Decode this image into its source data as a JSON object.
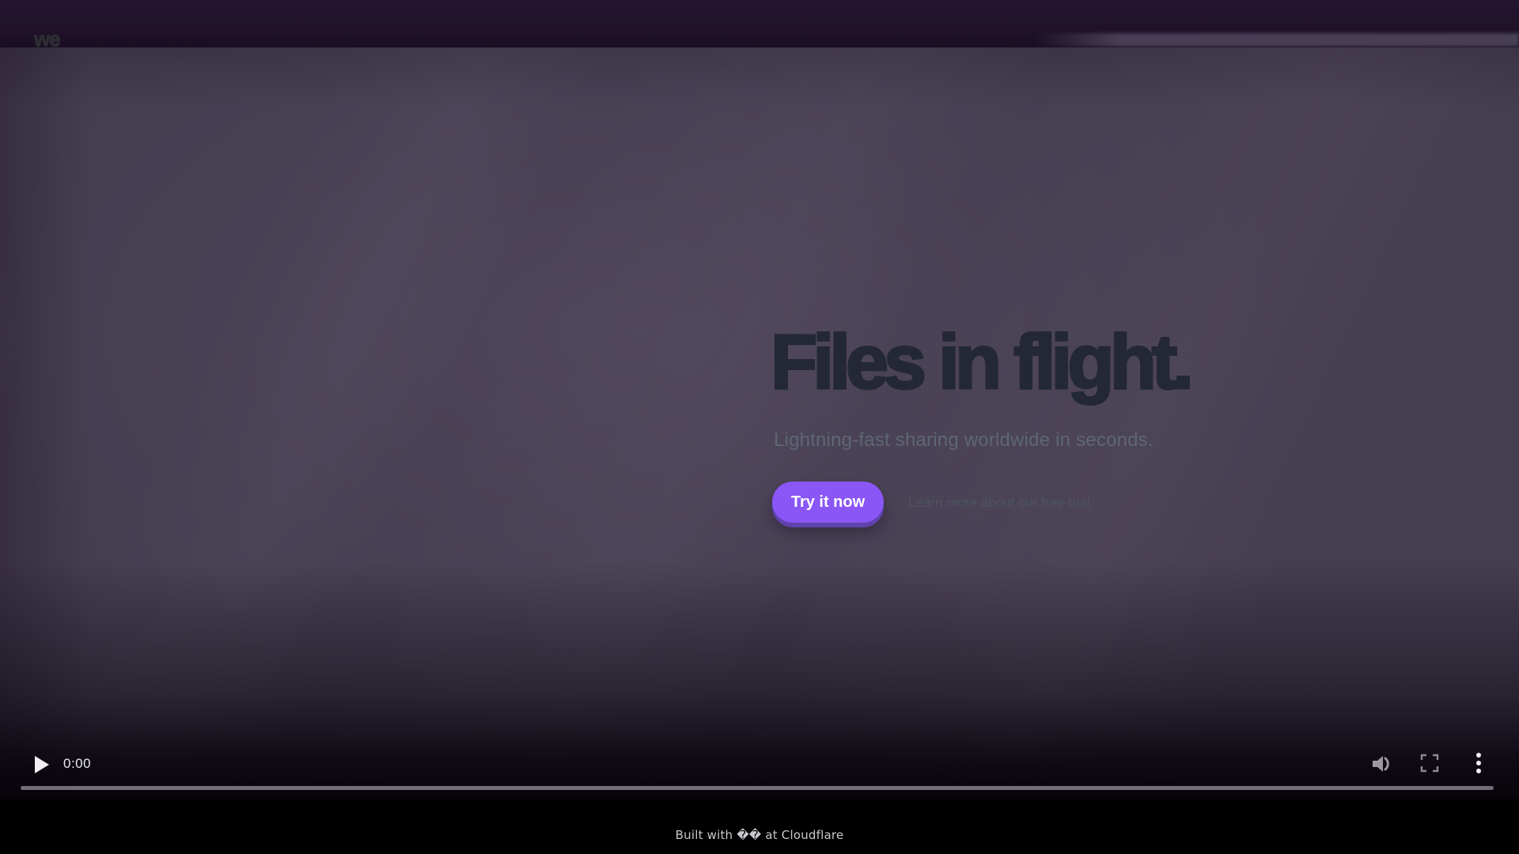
{
  "header": {
    "logo_text": "we"
  },
  "hero": {
    "headline": "Files in flight.",
    "subtitle": "Lightning-fast sharing worldwide in seconds.",
    "primary_button_label": "Try it now",
    "secondary_link_label": "Learn more about our free trial"
  },
  "video_player": {
    "current_time": "0:00",
    "icons": {
      "play": "play-icon",
      "volume": "volume-icon",
      "fullscreen": "fullscreen-icon",
      "overflow": "overflow-menu-icon"
    }
  },
  "footer": {
    "text": "Built with �� at Cloudflare"
  },
  "colors": {
    "header_bg": "#1e1128",
    "video_bg": "#453d50",
    "headline": "#232834",
    "subtitle": "#5d6773",
    "secondary_link": "#4d555f",
    "button_bg": "#8a56f6",
    "button_shadow": "#6145b2",
    "button_text": "#ffffff",
    "controls_text": "#edebf0",
    "progress_bar": "#716e78",
    "footer_text": "#c9c8ce"
  }
}
